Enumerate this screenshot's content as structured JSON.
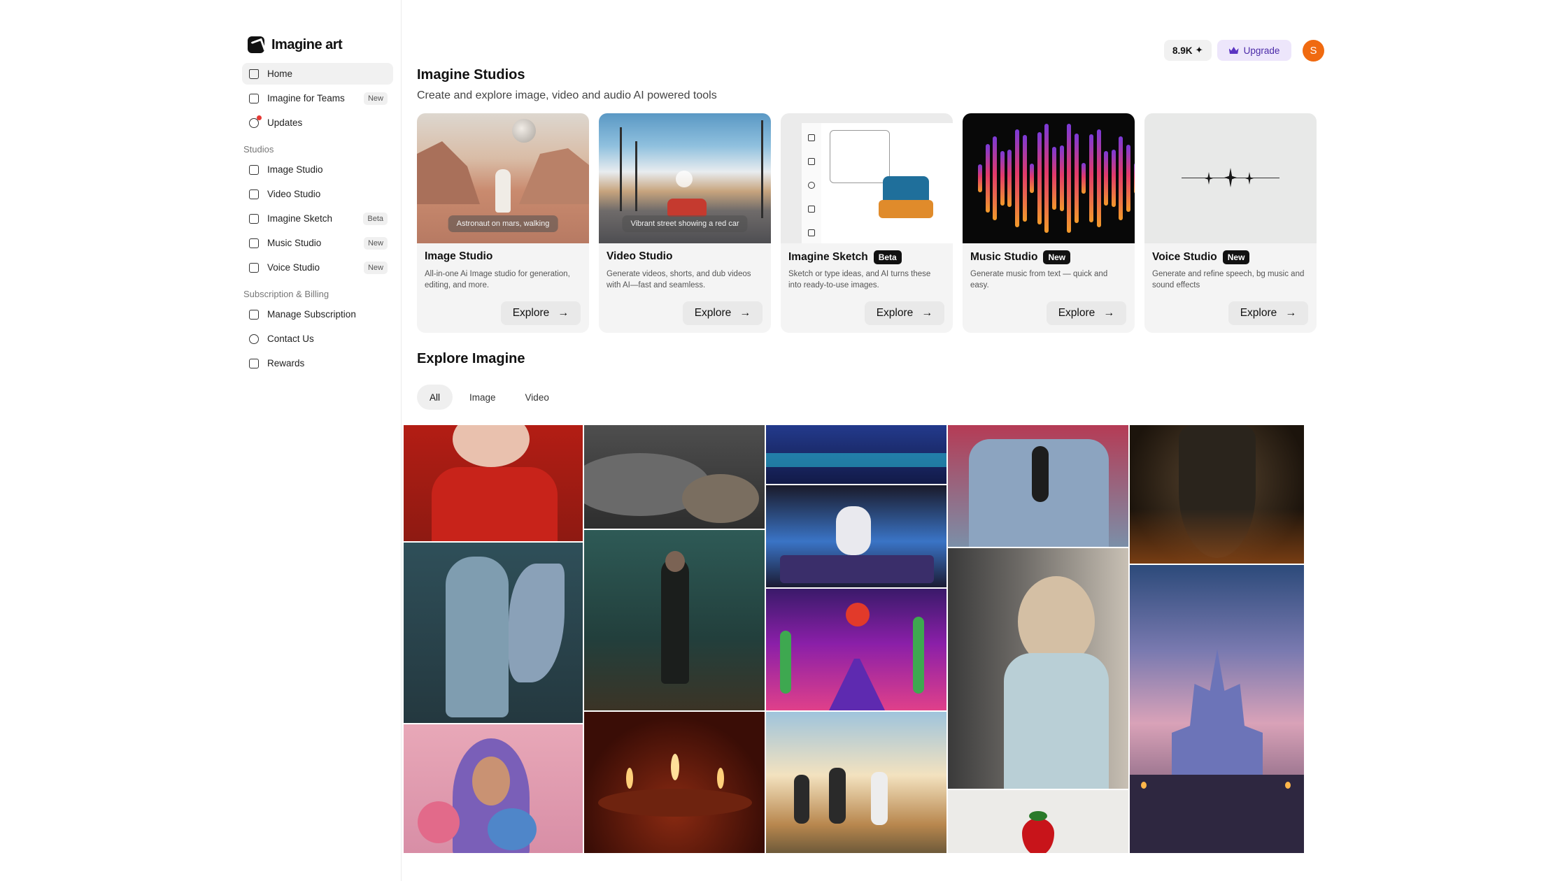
{
  "app": {
    "logo_text": "Imagine art"
  },
  "sidebar": {
    "items": [
      {
        "label": "Home",
        "icon": "home-icon",
        "active": true
      },
      {
        "label": "Imagine for Teams",
        "icon": "teams-icon",
        "badge": "New"
      },
      {
        "label": "Updates",
        "icon": "bell-icon"
      }
    ],
    "sections": [
      {
        "title": "Studios",
        "items": [
          {
            "label": "Image Studio",
            "icon": "image-icon"
          },
          {
            "label": "Video Studio",
            "icon": "video-icon"
          },
          {
            "label": "Imagine Sketch",
            "icon": "sketch-icon",
            "badge": "Beta"
          },
          {
            "label": "Music Studio",
            "icon": "music-icon",
            "badge": "New"
          },
          {
            "label": "Voice Studio",
            "icon": "voice-icon",
            "badge": "New"
          }
        ]
      },
      {
        "title": "Subscription & Billing",
        "items": [
          {
            "label": "Manage Subscription",
            "icon": "subscription-icon"
          },
          {
            "label": "Contact Us",
            "icon": "contact-icon"
          },
          {
            "label": "Rewards",
            "icon": "gift-icon"
          }
        ]
      }
    ]
  },
  "topbar": {
    "credits": "8.9K",
    "credits_icon": "sparkle-icon",
    "upgrade_label": "Upgrade",
    "upgrade_icon": "crown-icon",
    "avatar_initial": "S"
  },
  "studios": {
    "title": "Imagine Studios",
    "subtitle": "Create and explore image, video and audio AI powered tools",
    "cards": [
      {
        "title": "Image Studio",
        "badge": "",
        "desc": "All-in-one Ai Image studio for generation, editing, and more.",
        "caption": "Astronaut on mars, walking",
        "button": "Explore"
      },
      {
        "title": "Video Studio",
        "badge": "",
        "desc": "Generate videos, shorts, and dub videos with AI—fast and seamless.",
        "caption": "Vibrant street showing a red car",
        "button": "Explore"
      },
      {
        "title": "Imagine Sketch",
        "badge": "Beta",
        "desc": "Sketch or type ideas, and AI turns these into ready-to-use images.",
        "caption": "",
        "button": "Explore"
      },
      {
        "title": "Music Studio",
        "badge": "New",
        "desc": "Generate music from text — quick and easy.",
        "caption": "",
        "button": "Explore"
      },
      {
        "title": "Voice Studio",
        "badge": "New",
        "desc": "Generate and refine speech, bg music and sound effects",
        "caption": "",
        "button": "Explore"
      }
    ]
  },
  "explore": {
    "title": "Explore Imagine",
    "filters": [
      {
        "label": "All",
        "active": true
      },
      {
        "label": "Image"
      },
      {
        "label": "Video"
      }
    ]
  },
  "colors": {
    "accent_upgrade": "#ede6fb",
    "avatar": "#f06a10",
    "card_bg": "#f4f4f4"
  }
}
